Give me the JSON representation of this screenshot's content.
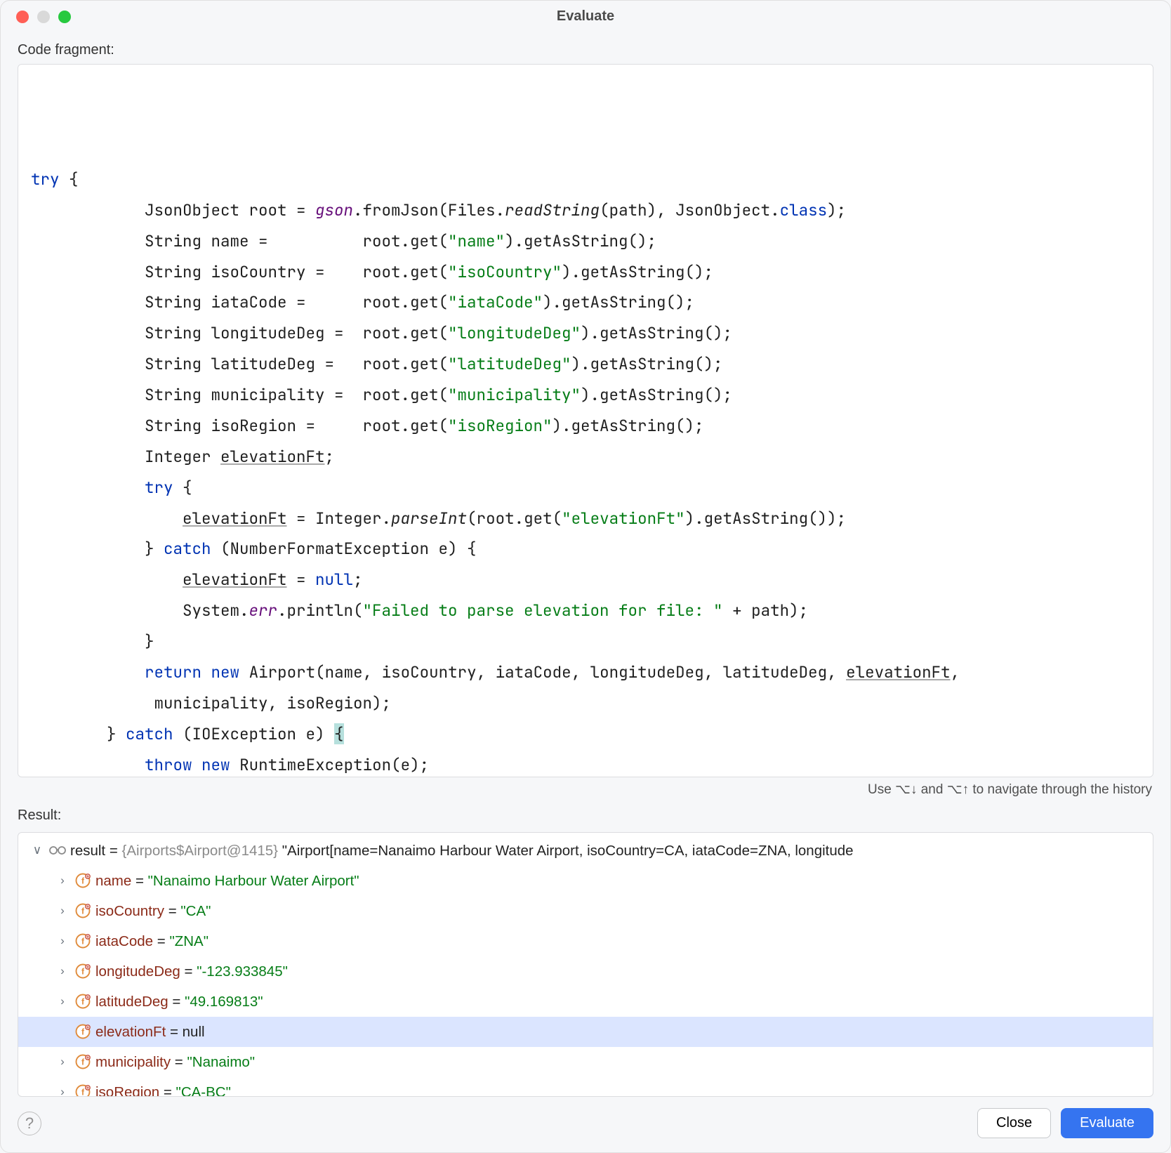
{
  "window": {
    "title": "Evaluate"
  },
  "labels": {
    "codeFragment": "Code fragment:",
    "result": "Result:",
    "hint": "Use ⌥↓ and ⌥↑ to navigate through the history"
  },
  "code_tokens": [
    [
      [
        "kw",
        "try"
      ],
      [
        "",
        " {"
      ]
    ],
    [
      [
        "",
        "            JsonObject root = "
      ],
      [
        "fld",
        "gson"
      ],
      [
        "",
        ".fromJson(Files."
      ],
      [
        "mtd-i",
        "readString"
      ],
      [
        "",
        "(path), JsonObject."
      ],
      [
        "kw",
        "class"
      ],
      [
        "",
        ");"
      ]
    ],
    [
      [
        "",
        "            String name =          root.get("
      ],
      [
        "str",
        "\"name\""
      ],
      [
        "",
        ").getAsString();"
      ]
    ],
    [
      [
        "",
        "            String isoCountry =    root.get("
      ],
      [
        "str",
        "\"isoCountry\""
      ],
      [
        "",
        ").getAsString();"
      ]
    ],
    [
      [
        "",
        "            String iataCode =      root.get("
      ],
      [
        "str",
        "\"iataCode\""
      ],
      [
        "",
        ").getAsString();"
      ]
    ],
    [
      [
        "",
        "            String longitudeDeg =  root.get("
      ],
      [
        "str",
        "\"longitudeDeg\""
      ],
      [
        "",
        ").getAsString();"
      ]
    ],
    [
      [
        "",
        "            String latitudeDeg =   root.get("
      ],
      [
        "str",
        "\"latitudeDeg\""
      ],
      [
        "",
        ").getAsString();"
      ]
    ],
    [
      [
        "",
        "            String municipality =  root.get("
      ],
      [
        "str",
        "\"municipality\""
      ],
      [
        "",
        ").getAsString();"
      ]
    ],
    [
      [
        "",
        "            String isoRegion =     root.get("
      ],
      [
        "str",
        "\"isoRegion\""
      ],
      [
        "",
        ").getAsString();"
      ]
    ],
    [
      [
        "",
        "            Integer "
      ],
      [
        "ul",
        "elevationFt"
      ],
      [
        "",
        ";"
      ]
    ],
    [
      [
        "",
        "            "
      ],
      [
        "kw",
        "try"
      ],
      [
        "",
        " {"
      ]
    ],
    [
      [
        "",
        "                "
      ],
      [
        "ul",
        "elevationFt"
      ],
      [
        "",
        " = Integer."
      ],
      [
        "mtd-i",
        "parseInt"
      ],
      [
        "",
        "(root.get("
      ],
      [
        "str",
        "\"elevationFt\""
      ],
      [
        "",
        ").getAsString());"
      ]
    ],
    [
      [
        "",
        "            } "
      ],
      [
        "kw",
        "catch"
      ],
      [
        "",
        " (NumberFormatException e) {"
      ]
    ],
    [
      [
        "",
        "                "
      ],
      [
        "ul",
        "elevationFt"
      ],
      [
        "",
        " = "
      ],
      [
        "kw",
        "null"
      ],
      [
        "",
        ";"
      ]
    ],
    [
      [
        "",
        "                System."
      ],
      [
        "fld",
        "err"
      ],
      [
        "",
        ".println("
      ],
      [
        "str",
        "\"Failed to parse elevation for file: \""
      ],
      [
        "",
        " + path);"
      ]
    ],
    [
      [
        "",
        "            }"
      ]
    ],
    [
      [
        "",
        "            "
      ],
      [
        "kw",
        "return"
      ],
      [
        "",
        " "
      ],
      [
        "kw",
        "new"
      ],
      [
        "",
        " Airport(name, isoCountry, iataCode, longitudeDeg, latitudeDeg, "
      ],
      [
        "ul",
        "elevationFt"
      ],
      [
        "",
        ","
      ]
    ],
    [
      [
        "",
        "             municipality, isoRegion);"
      ]
    ],
    [
      [
        "",
        "        } "
      ],
      [
        "kw",
        "catch"
      ],
      [
        "",
        " (IOException e) "
      ],
      [
        "hl",
        "{"
      ]
    ],
    [
      [
        "",
        "            "
      ],
      [
        "kw",
        "throw"
      ],
      [
        "",
        " "
      ],
      [
        "kw",
        "new"
      ],
      [
        "",
        " RuntimeException(e);"
      ]
    ],
    [
      [
        "",
        "        "
      ],
      [
        "hl",
        "}"
      ]
    ]
  ],
  "result": {
    "root": {
      "name": "result",
      "typeHint": "{Airports$Airport@1415}",
      "toString": "\"Airport[name=Nanaimo Harbour Water Airport, isoCountry=CA, iataCode=ZNA, longitude"
    },
    "fields": [
      {
        "name": "name",
        "value": "\"Nanaimo Harbour Water Airport\"",
        "kind": "string",
        "expandable": true,
        "selected": false
      },
      {
        "name": "isoCountry",
        "value": "\"CA\"",
        "kind": "string",
        "expandable": true,
        "selected": false
      },
      {
        "name": "iataCode",
        "value": "\"ZNA\"",
        "kind": "string",
        "expandable": true,
        "selected": false
      },
      {
        "name": "longitudeDeg",
        "value": "\"-123.933845\"",
        "kind": "string",
        "expandable": true,
        "selected": false
      },
      {
        "name": "latitudeDeg",
        "value": "\"49.169813\"",
        "kind": "string",
        "expandable": true,
        "selected": false
      },
      {
        "name": "elevationFt",
        "value": "null",
        "kind": "null",
        "expandable": false,
        "selected": true
      },
      {
        "name": "municipality",
        "value": "\"Nanaimo\"",
        "kind": "string",
        "expandable": true,
        "selected": false
      },
      {
        "name": "isoRegion",
        "value": "\"CA-BC\"",
        "kind": "string",
        "expandable": true,
        "selected": false
      }
    ]
  },
  "buttons": {
    "close": "Close",
    "evaluate": "Evaluate"
  }
}
